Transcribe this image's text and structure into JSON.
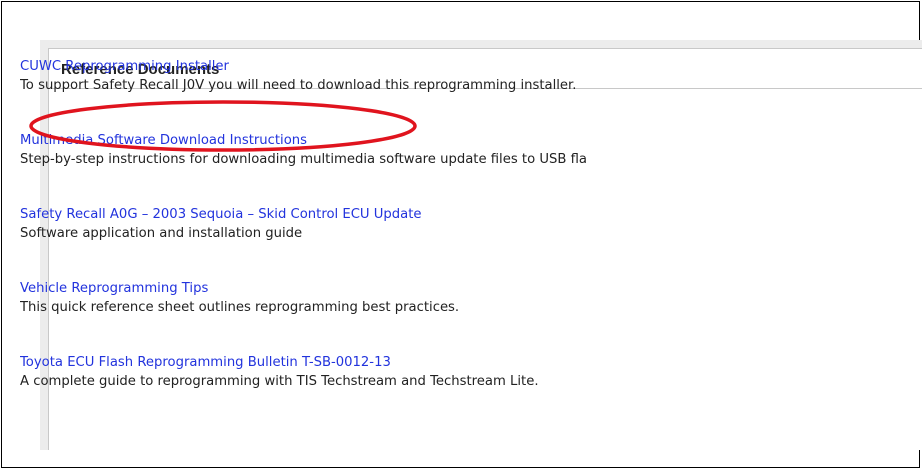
{
  "panel": {
    "title": "Reference Documents"
  },
  "documents": [
    {
      "title": "CUWC Reprogramming Installer",
      "description": "To support Safety Recall J0V you will need to download this reprogramming installer."
    },
    {
      "title": "Multimedia Software Download Instructions",
      "description": "Step-by-step instructions for downloading multimedia software update files to USB fla"
    },
    {
      "title": "Safety Recall A0G – 2003 Sequoia – Skid Control ECU Update",
      "description": "Software application and installation guide"
    },
    {
      "title": "Vehicle Reprogramming Tips",
      "description": "This quick reference sheet outlines reprogramming best practices."
    },
    {
      "title": "Toyota ECU Flash Reprogramming Bulletin T-SB-0012-13",
      "description": "A complete guide to reprogramming with TIS Techstream and Techstream Lite."
    }
  ],
  "colors": {
    "link": "#2233dd",
    "highlight": "#e0141e",
    "panel_background": "#ececec"
  }
}
